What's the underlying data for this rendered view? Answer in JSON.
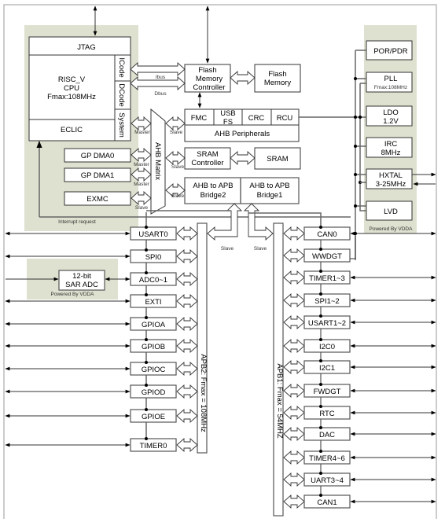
{
  "cpu_core": {
    "jtag": "JTAG",
    "cpu_lines": [
      "RISC_V",
      "CPU",
      "Fmax:108MHz"
    ],
    "eclic": "ECLIC",
    "ports": [
      "ICode",
      "DCode",
      "System"
    ]
  },
  "buses": {
    "ibus": "Ibus",
    "dbus": "Dbus",
    "master": "Master",
    "slave": "Slave",
    "interrupt_request": "Interrupt request",
    "ahb_matrix": "AHB Matrix",
    "apb2": "APB2: Fmax = 108MHz",
    "apb1": "APB1: Fmax = 54MHZ"
  },
  "flash": {
    "controller_lines": [
      "Flash",
      "Memory",
      "Controller"
    ],
    "memory_lines": [
      "Flash",
      "Memory"
    ]
  },
  "ahb_peripherals": {
    "cells": [
      "FMC",
      "USB",
      "FS",
      "CRC",
      "RCU"
    ],
    "label": "AHB Peripherals"
  },
  "sram": {
    "controller_lines": [
      "SRAM",
      "Controller"
    ],
    "memory": "SRAM"
  },
  "bridges": {
    "bridge2_lines": [
      "AHB to APB",
      "Bridge2"
    ],
    "bridge1_lines": [
      "AHB to APB",
      "Bridge1"
    ]
  },
  "masters": [
    "GP DMA0",
    "GP DMA1",
    "EXMC"
  ],
  "clock_power": {
    "por_pdr": "POR/PDR",
    "pll": "PLL",
    "pll_sub": "Fmax:108MHz",
    "ldo_lines": [
      "LDO",
      "1.2V"
    ],
    "irc_lines": [
      "IRC",
      "8MHz"
    ],
    "hxtal_lines": [
      "HXTAL",
      "3-25MHz"
    ],
    "lvd": "LVD",
    "powered_by": "Powered By VDDA"
  },
  "adc": {
    "lines": [
      "12-bit",
      "SAR ADC"
    ],
    "powered_by": "Powered By VDDA"
  },
  "apb2_peripherals": [
    "USART0",
    "SPI0",
    "ADC0~1",
    "EXTI",
    "GPIOA",
    "GPIOB",
    "GPIOC",
    "GPIOD",
    "GPIOE",
    "TIMER0"
  ],
  "apb1_peripherals": [
    "CAN0",
    "WWDGT",
    "TIMER1~3",
    "SPI1~2",
    "USART1~2",
    "I2C0",
    "I2C1",
    "FWDGT",
    "RTC",
    "DAC",
    "TIMER4~6",
    "UART3~4",
    "CAN1"
  ],
  "colors": {
    "region_fill": "#dee1cf",
    "line": "#333333",
    "frame": "#bbbbbb"
  }
}
